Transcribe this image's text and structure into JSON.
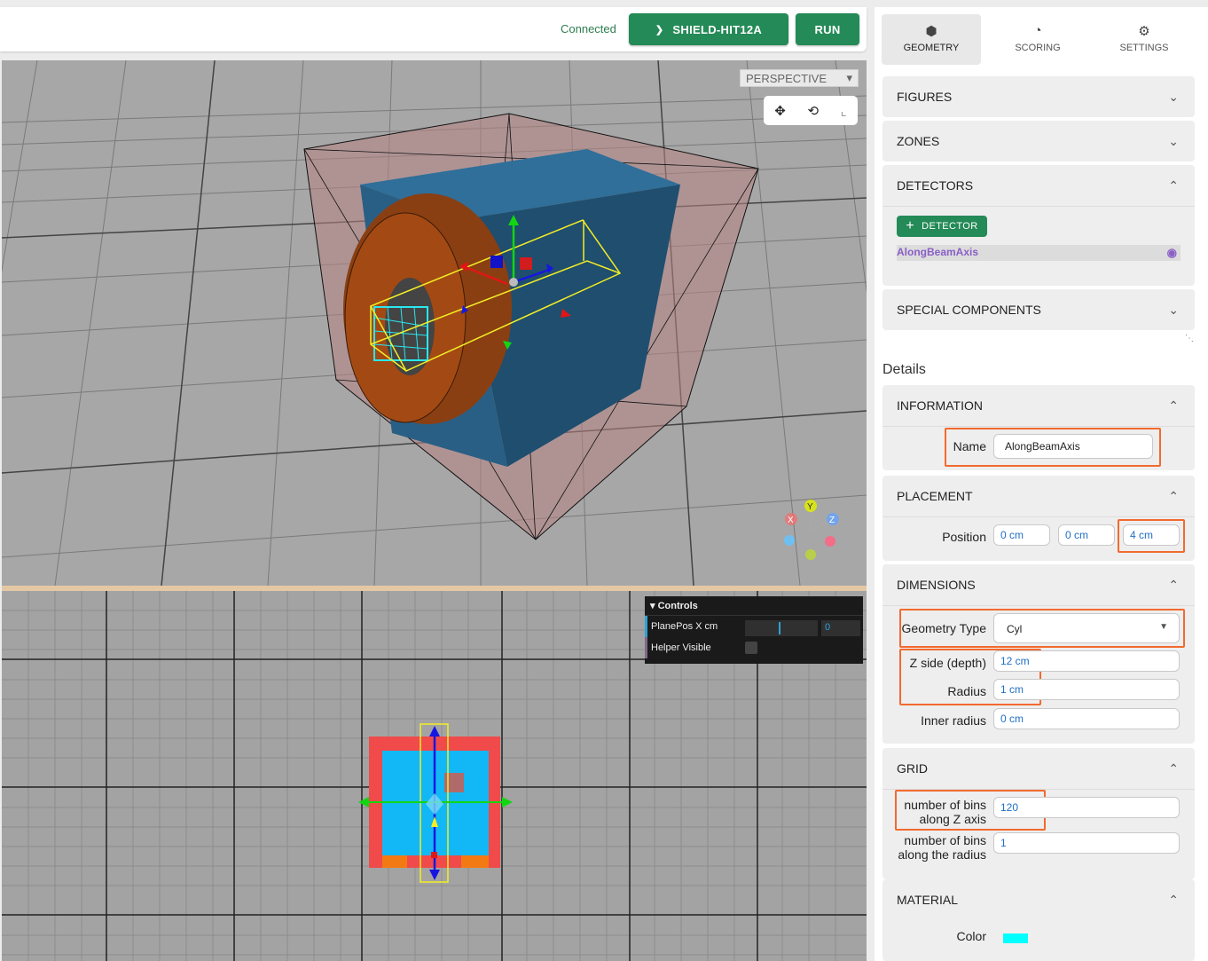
{
  "topbar": {
    "status": "Connected",
    "simulator_label": "SHIELD-HIT12A",
    "run_label": "RUN"
  },
  "viewport3d": {
    "camera_mode": "PERSPECTIVE"
  },
  "viewport2d": {
    "controls": {
      "title": "Controls",
      "plane_pos_label": "PlanePos X cm",
      "plane_pos_value": "0",
      "helper_visible_label": "Helper Visible"
    }
  },
  "gizmo": {
    "x": "X",
    "y": "Y",
    "z": "Z"
  },
  "tabs": [
    {
      "label": "GEOMETRY",
      "icon": "cube-icon"
    },
    {
      "label": "SCORING",
      "icon": "gauge-icon"
    },
    {
      "label": "SETTINGS",
      "icon": "gear-icon"
    }
  ],
  "sections": {
    "figures": "FIGURES",
    "zones": "ZONES",
    "detectors": "DETECTORS",
    "special": "SPECIAL COMPONENTS"
  },
  "detectors": {
    "add_label": "DETECTOR",
    "items": [
      {
        "name": "AlongBeamAxis"
      }
    ]
  },
  "details": {
    "title": "Details",
    "information": {
      "title": "INFORMATION",
      "name_label": "Name",
      "name_value": "AlongBeamAxis"
    },
    "placement": {
      "title": "PLACEMENT",
      "position_label": "Position",
      "x": "0 cm",
      "y": "0 cm",
      "z": "4 cm"
    },
    "dimensions": {
      "title": "DIMENSIONS",
      "geometry_type_label": "Geometry Type",
      "geometry_type_value": "Cyl",
      "z_side_label": "Z side (depth)",
      "z_side_value": "12 cm",
      "radius_label": "Radius",
      "radius_value": "1 cm",
      "inner_radius_label": "Inner radius",
      "inner_radius_value": "0 cm"
    },
    "grid": {
      "title": "GRID",
      "bins_z_label_1": "number of bins",
      "bins_z_label_2": "along Z axis",
      "bins_z_value": "120",
      "bins_r_label_1": "number of bins",
      "bins_r_label_2": "along the radius",
      "bins_r_value": "1"
    },
    "material": {
      "title": "MATERIAL",
      "color_label": "Color",
      "color_value": "#00ffff"
    }
  },
  "colors": {
    "accent": "#248a57",
    "highlight": "#f26a2e",
    "detector": "#8a5fc6"
  }
}
